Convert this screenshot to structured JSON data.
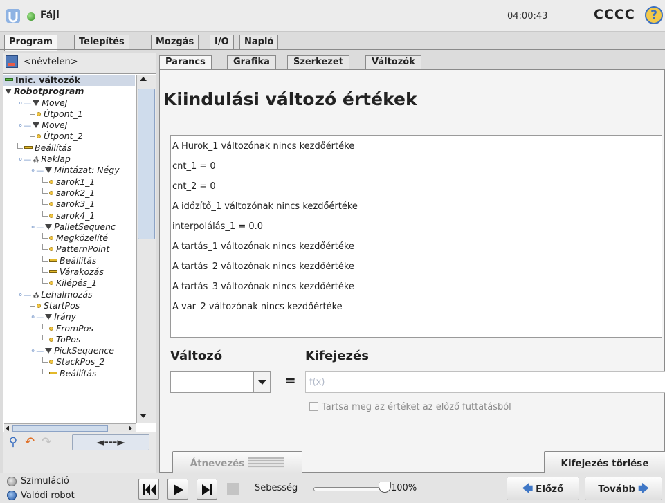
{
  "header": {
    "file_label": "Fájl",
    "clock": "04:00:43",
    "robot_name": "CCCC",
    "help_symbol": "?"
  },
  "main_tabs": [
    "Program",
    "Telepítés",
    "Mozgás",
    "I/O",
    "Napló"
  ],
  "main_tab_active": "Program",
  "program_name": "<névtelen>",
  "tree": [
    {
      "label": "Inic. változók",
      "icon": "green-bar-icon",
      "indent": 0,
      "bold": true,
      "selected": true
    },
    {
      "label": "Robotprogram",
      "icon": "triangle-icon",
      "indent": 0,
      "bold": true
    },
    {
      "label": "MoveJ",
      "icon": "triangle-icon",
      "indent": 1
    },
    {
      "label": "Útpont_1",
      "icon": "waypoint-icon",
      "indent": 2
    },
    {
      "label": "MoveJ",
      "icon": "triangle-icon",
      "indent": 1
    },
    {
      "label": "Útpont_2",
      "icon": "waypoint-icon",
      "indent": 2
    },
    {
      "label": "Beállítás",
      "icon": "set-bar-icon",
      "indent": 1
    },
    {
      "label": "Raklap",
      "icon": "pallet-icon",
      "indent": 1
    },
    {
      "label": "Mintázat: Négy",
      "icon": "triangle-icon",
      "indent": 2
    },
    {
      "label": "sarok1_1",
      "icon": "waypoint-icon",
      "indent": 3
    },
    {
      "label": "sarok2_1",
      "icon": "waypoint-icon",
      "indent": 3
    },
    {
      "label": "sarok3_1",
      "icon": "waypoint-icon",
      "indent": 3
    },
    {
      "label": "sarok4_1",
      "icon": "waypoint-icon",
      "indent": 3
    },
    {
      "label": "PalletSequenc",
      "icon": "triangle-icon",
      "indent": 2
    },
    {
      "label": "Megközelíté",
      "icon": "waypoint-icon",
      "indent": 3
    },
    {
      "label": "PatternPoint",
      "icon": "waypoint-icon",
      "indent": 3
    },
    {
      "label": "Beállítás",
      "icon": "set-bar-icon",
      "indent": 3
    },
    {
      "label": "Várakozás",
      "icon": "set-bar-icon",
      "indent": 3
    },
    {
      "label": "Kilépés_1",
      "icon": "waypoint-icon",
      "indent": 3
    },
    {
      "label": "Lehalmozás",
      "icon": "pallet-icon",
      "indent": 1
    },
    {
      "label": "StartPos",
      "icon": "waypoint-icon",
      "indent": 2
    },
    {
      "label": "Irány",
      "icon": "triangle-icon",
      "indent": 2
    },
    {
      "label": "FromPos",
      "icon": "waypoint-icon",
      "indent": 3
    },
    {
      "label": "ToPos",
      "icon": "waypoint-icon",
      "indent": 3
    },
    {
      "label": "PickSequence",
      "icon": "triangle-icon",
      "indent": 2
    },
    {
      "label": "StackPos_2",
      "icon": "waypoint-icon",
      "indent": 3
    },
    {
      "label": "Beállítás",
      "icon": "set-bar-icon",
      "indent": 3
    }
  ],
  "left_toolbar": {
    "search_icon": "search-icon",
    "undo_icon": "undo-icon",
    "redo_icon": "redo-icon",
    "move_label": "◄---►"
  },
  "sub_tabs": [
    "Parancs",
    "Grafika",
    "Szerkezet",
    "Változók"
  ],
  "sub_tab_active": "Parancs",
  "page_title": "Kiindulási változó értékek",
  "variables": [
    "A Hurok_1 változónak nincs kezdőértéke",
    "cnt_1 = 0",
    "cnt_2 = 0",
    "A időzítő_1 változónak nincs kezdőértéke",
    "interpolálás_1 = 0.0",
    "A tartás_1 változónak nincs kezdőértéke",
    "A tartás_2 változónak nincs kezdőértéke",
    "A tartás_3 változónak nincs kezdőértéke",
    "A var_2 változónak nincs kezdőértéke"
  ],
  "editor": {
    "variable_label": "Változó",
    "expression_label": "Kifejezés",
    "equals": "=",
    "expression_placeholder": "f(x)",
    "keep_value_label": "Tartsa meg az értéket az előző futtatásból",
    "rename_label": "Átnevezés",
    "clear_label": "Kifejezés törlése"
  },
  "footer": {
    "simulation_label": "Szimuláció",
    "real_robot_label": "Valódi robot",
    "speed_label": "Sebesség",
    "speed_value": "100%",
    "speed_fraction": 1.0,
    "prev_label": "Előző",
    "next_label": "Tovább"
  },
  "colors": {
    "accent_blue": "#3f77c6",
    "status_green": "#2e8b1e",
    "help_yellow": "#f1c84b",
    "waypoint_yellow": "#f3c743"
  }
}
